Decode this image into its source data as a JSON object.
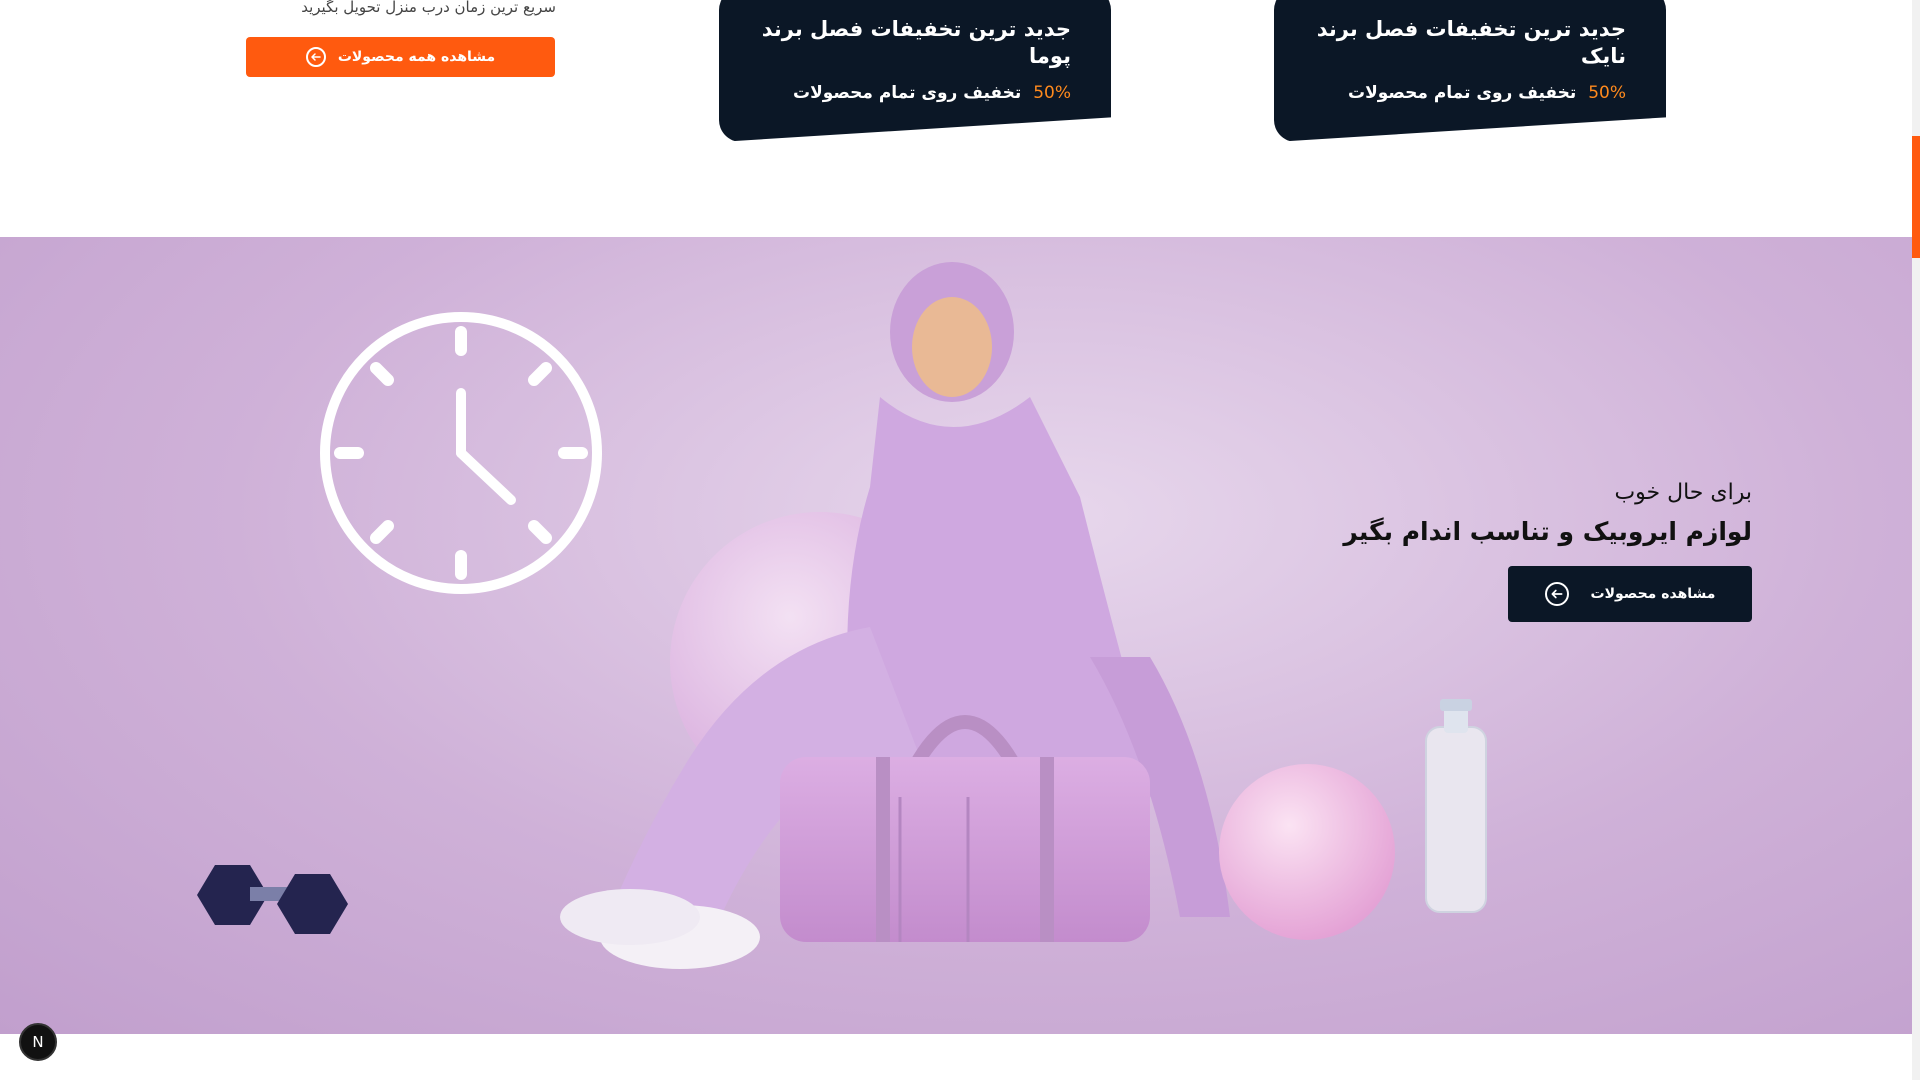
{
  "top_promo": {
    "subtitle": "سریع ترین زمان درب منزل تحویل بگیرید",
    "button_label": "مشاهده همه محصولات"
  },
  "cards": [
    {
      "title": "جدید ترین تخفیفات فصل برند پوما",
      "percent": "50%",
      "caption": "تخفیف روی تمام محصولات"
    },
    {
      "title": "جدید ترین تخفیفات فصل برند نایک",
      "percent": "50%",
      "caption": "تخفیف روی تمام محصولات"
    }
  ],
  "hero": {
    "kicker": "برای حال خوب",
    "title": "لوازم ایروبیک و تناسب اندام بگیر",
    "button_label": "مشاهده محصولات"
  },
  "badge": {
    "letter": "N"
  },
  "colors": {
    "accent": "#ff5a0f",
    "dark": "#0b1726",
    "hero_bg": "#d4b8dc",
    "percent": "#ff8a1d"
  },
  "icons": [
    "arrow-left-circle-icon",
    "clock-icon"
  ]
}
